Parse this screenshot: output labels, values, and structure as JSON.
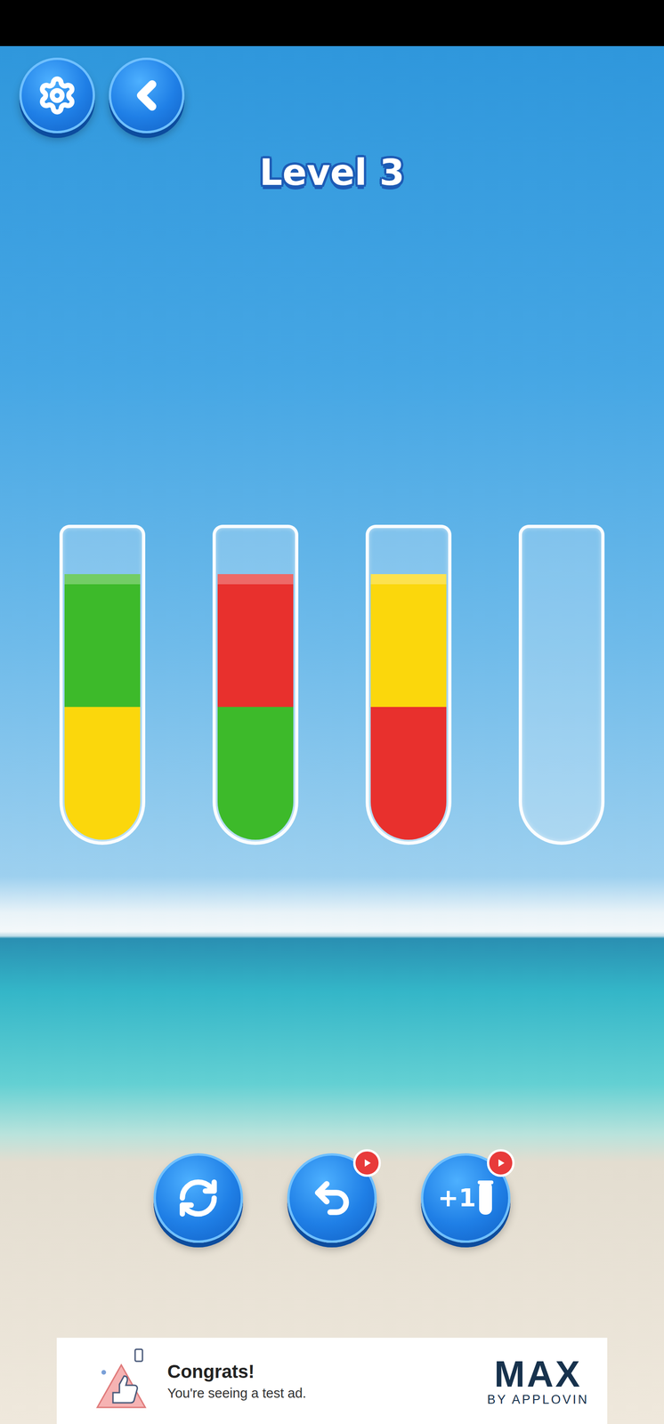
{
  "level": {
    "title": "Level 3"
  },
  "tubes": [
    {
      "layers": [
        {
          "color": "#fbd70c"
        },
        {
          "color": "#3dba2a"
        }
      ]
    },
    {
      "layers": [
        {
          "color": "#3dba2a"
        },
        {
          "color": "#e8302d"
        }
      ]
    },
    {
      "layers": [
        {
          "color": "#e8302d"
        },
        {
          "color": "#fbd70c"
        }
      ]
    },
    {
      "layers": []
    }
  ],
  "controls": [
    {
      "kind": "restart",
      "label": "",
      "ad": false
    },
    {
      "kind": "undo",
      "label": "",
      "ad": true
    },
    {
      "kind": "add-tube",
      "label": "+1",
      "ad": true
    }
  ],
  "ad": {
    "title": "Congrats!",
    "subtitle": "You're seeing a test ad.",
    "brand": "MAX",
    "brand_sub": "BY APPLOVIN"
  }
}
